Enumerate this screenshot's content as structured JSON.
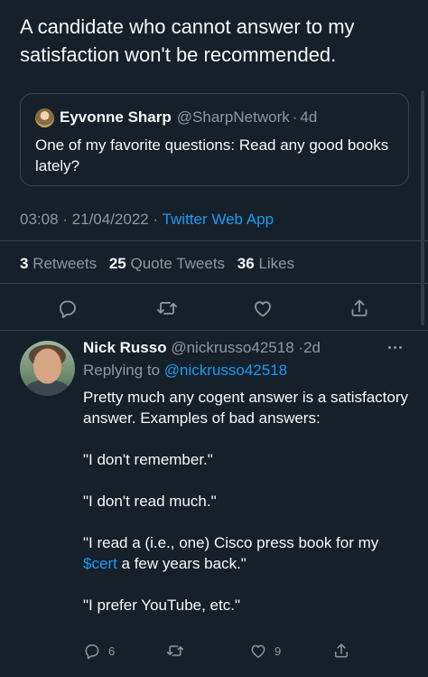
{
  "tweet": {
    "text": "A candidate who cannot answer to my satisfaction won't be recommended.",
    "time": "03:08",
    "date": "21/04/2022",
    "source": "Twitter Web App",
    "stats": {
      "retweets_count": "3",
      "retweets_label": "Retweets",
      "quotes_count": "25",
      "quotes_label": "Quote Tweets",
      "likes_count": "36",
      "likes_label": "Likes"
    }
  },
  "quoted": {
    "name": "Eyvonne Sharp",
    "handle": "@SharpNetwork",
    "age": "4d",
    "text": "One of my favorite questions: Read any good books lately?"
  },
  "reply": {
    "name": "Nick Russo",
    "handle": "@nickrusso42518",
    "age": "2d",
    "replying_prefix": "Replying to",
    "replying_to": "@nickrusso42518",
    "line1": "Pretty much any cogent answer is a satisfactory answer. Examples of bad answers:",
    "line2": "\"I don't remember.\"",
    "line3": "\"I don't read much.\"",
    "line4_pre": "\"I read a (i.e., one) Cisco press book for my ",
    "line4_tag": "$cert",
    "line4_post": " a few years back.\"",
    "line5": "\"I prefer YouTube, etc.\"",
    "reply_count": "6",
    "like_count": "9"
  },
  "colors": {
    "background": "#15202b",
    "text": "#f7f9f9",
    "muted": "#8b98a5",
    "link": "#1d9bf0",
    "border": "#38444d"
  },
  "icons": [
    "reply-icon",
    "retweet-icon",
    "like-icon",
    "share-icon",
    "more-icon"
  ]
}
